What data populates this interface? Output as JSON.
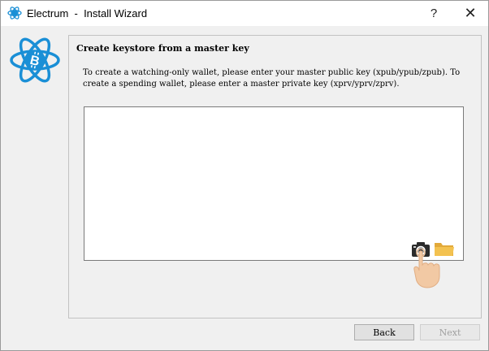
{
  "window": {
    "title": "Electrum  -  Install Wizard",
    "help_label": "?",
    "close_label": "✕"
  },
  "panel": {
    "heading": "Create keystore from a master key",
    "description": "To create a watching-only wallet, please enter your master public key (xpub/ypub/zpub). To create a spending wallet, please enter a master private key (xprv/yprv/zprv).",
    "key_input_value": "",
    "key_input_placeholder": ""
  },
  "icons": {
    "logo": "electrum-bitcoin-atom-logo",
    "camera": "qr-scan-camera-icon",
    "folder": "open-file-folder-icon",
    "pointer": "hand-pointer-icon"
  },
  "buttons": {
    "back_label": "Back",
    "next_label": "Next"
  },
  "colors": {
    "logo_blue": "#1a8fd6",
    "folder_yellow": "#f3c250",
    "hand_skin": "#f2c9a4"
  }
}
